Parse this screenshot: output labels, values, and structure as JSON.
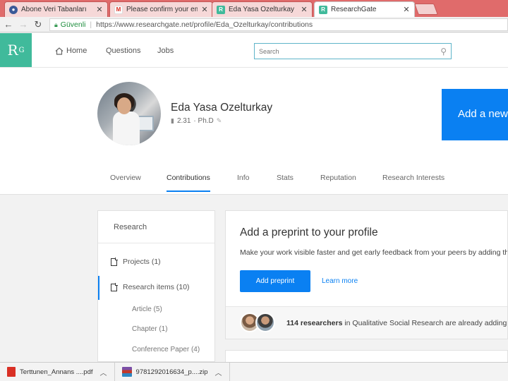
{
  "browser": {
    "tabs": [
      {
        "title": "Abone Veri Tabanları",
        "favicon": "globe-icon",
        "color": "#3b5998"
      },
      {
        "title": "Please confirm your email",
        "favicon": "gmail-icon",
        "color": "#d93025"
      },
      {
        "title": "Eda Yasa Ozelturkay",
        "favicon": "researchgate-icon",
        "color": "#40ba9b"
      },
      {
        "title": "ResearchGate",
        "favicon": "researchgate-icon",
        "color": "#40ba9b"
      }
    ],
    "active_tab_index": 3,
    "secure_label": "Güvenli",
    "url": "https://www.researchgate.net/profile/Eda_Ozelturkay/contributions"
  },
  "rg_header": {
    "logo": "R",
    "logo_sup": "G",
    "nav": {
      "home": "Home",
      "questions": "Questions",
      "jobs": "Jobs"
    },
    "search_placeholder": "Search"
  },
  "profile": {
    "name": "Eda Yasa Ozelturkay",
    "score": "2.31",
    "degree": "· Ph.D",
    "add_button": "Add a new",
    "tabs": [
      "Overview",
      "Contributions",
      "Info",
      "Stats",
      "Reputation",
      "Research Interests"
    ],
    "active_tab": "Contributions"
  },
  "sidebar": {
    "title": "Research",
    "items": [
      {
        "label": "Projects (1)"
      },
      {
        "label": "Research items (10)"
      }
    ],
    "subitems": [
      "Article (5)",
      "Chapter (1)",
      "Conference Paper (4)"
    ]
  },
  "preprint_card": {
    "title": "Add a preprint to your profile",
    "description": "Make your work visible faster and get early feedback from your peers by adding the",
    "button": "Add preprint",
    "learn_more": "Learn more",
    "researchers_count": "114 researchers",
    "researchers_text": " in Qualitative Social Research are already adding p"
  },
  "downloads": [
    {
      "name": "Terttunen_Annans ....pdf",
      "type": "pdf-icon"
    },
    {
      "name": "9781292016634_p....zip",
      "type": "zip-icon"
    }
  ],
  "colors": {
    "tab_strip": "#e06b6b",
    "rg_green": "#40ba9b",
    "accent_blue": "#0a80f2"
  }
}
